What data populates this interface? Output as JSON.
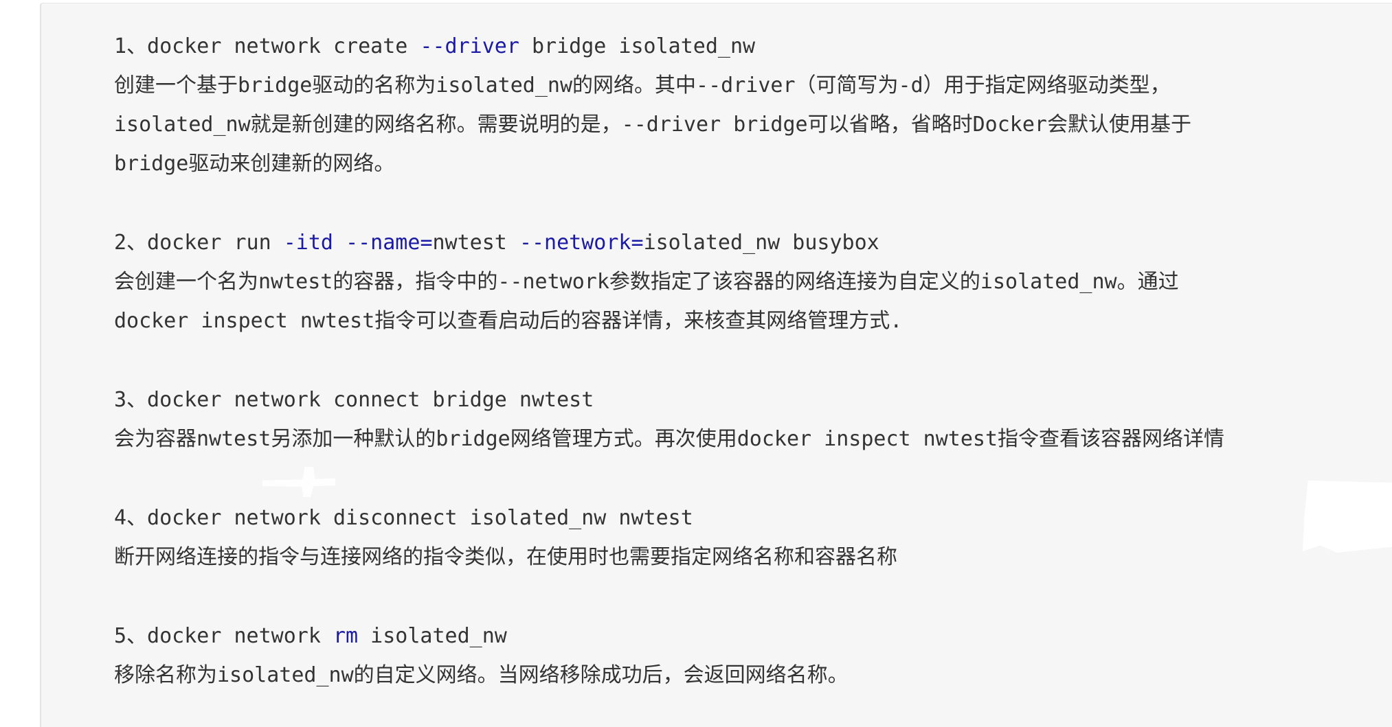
{
  "colors": {
    "panel_background": "#f6f6f6",
    "text": "#333333",
    "code_keyword": "#1a1aa6"
  },
  "blocks": [
    {
      "command": {
        "prefix": "1、docker network create ",
        "flag": "--driver",
        "rest": " bridge isolated_nw"
      },
      "description_lines": [
        "创建一个基于bridge驱动的名称为isolated_nw的网络。其中--driver（可简写为-d）用于指定网络驱动类型，",
        "isolated_nw就是新创建的网络名称。需要说明的是，--driver bridge可以省略，省略时Docker会默认使用基于",
        "bridge驱动来创建新的网络。"
      ]
    },
    {
      "command": {
        "prefix": "2、docker run ",
        "flag1": "-itd",
        "sep1": " ",
        "flag2": "--name",
        "eq1": "=",
        "val1": "nwtest ",
        "flag3": "--network",
        "eq2": "=",
        "val2": "isolated_nw busybox"
      },
      "description_lines": [
        "会创建一个名为nwtest的容器，指令中的--network参数指定了该容器的网络连接为自定义的isolated_nw。通过",
        "docker inspect nwtest指令可以查看启动后的容器详情，来核查其网络管理方式."
      ]
    },
    {
      "command": {
        "text": "3、docker network connect bridge nwtest"
      },
      "description_lines": [
        "会为容器nwtest另添加一种默认的bridge网络管理方式。再次使用docker inspect nwtest指令查看该容器网络详情"
      ]
    },
    {
      "command": {
        "text": "4、docker network disconnect isolated_nw nwtest"
      },
      "description_lines": [
        "断开网络连接的指令与连接网络的指令类似，在使用时也需要指定网络名称和容器名称"
      ]
    },
    {
      "command": {
        "prefix": "5、docker network ",
        "kw": "rm",
        "rest": " isolated_nw"
      },
      "description_lines": [
        "移除名称为isolated_nw的自定义网络。当网络移除成功后，会返回网络名称。"
      ]
    }
  ]
}
